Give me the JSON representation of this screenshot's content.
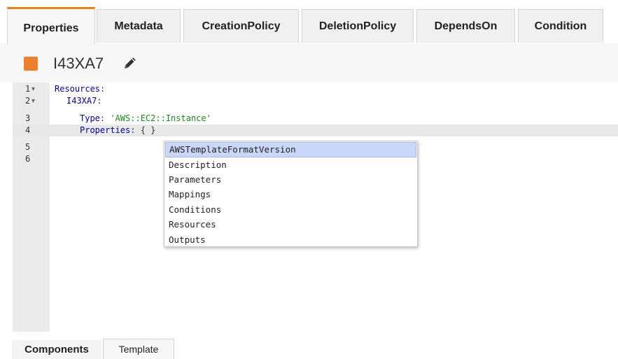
{
  "tabs": [
    {
      "label": "Properties",
      "active": true
    },
    {
      "label": "Metadata",
      "active": false
    },
    {
      "label": "CreationPolicy",
      "active": false
    },
    {
      "label": "DeletionPolicy",
      "active": false
    },
    {
      "label": "DependsOn",
      "active": false
    },
    {
      "label": "Condition",
      "active": false
    }
  ],
  "resource": {
    "name": "I43XA7",
    "color": "#ee7f2d",
    "edit_icon": "pencil-icon"
  },
  "editor": {
    "line_numbers": [
      "1",
      "2",
      "3",
      "4",
      "5",
      "6"
    ],
    "fold_marker": "▾",
    "line1": {
      "key": "Resources",
      "colon": ":"
    },
    "line2": {
      "key": "I43XA7",
      "colon": ":"
    },
    "line3": {
      "key": "Type",
      "colon": ": ",
      "value": "'AWS::EC2::Instance'"
    },
    "line4": {
      "key": "Properties",
      "colon": ": ",
      "value": "{ }"
    },
    "current_line": "4"
  },
  "autocomplete": {
    "items": [
      "AWSTemplateFormatVersion",
      "Description",
      "Parameters",
      "Mappings",
      "Conditions",
      "Resources",
      "Outputs"
    ],
    "selected_index": 0
  },
  "bottom_tabs": [
    {
      "label": "Components",
      "active": true
    },
    {
      "label": "Template",
      "active": false
    }
  ]
}
